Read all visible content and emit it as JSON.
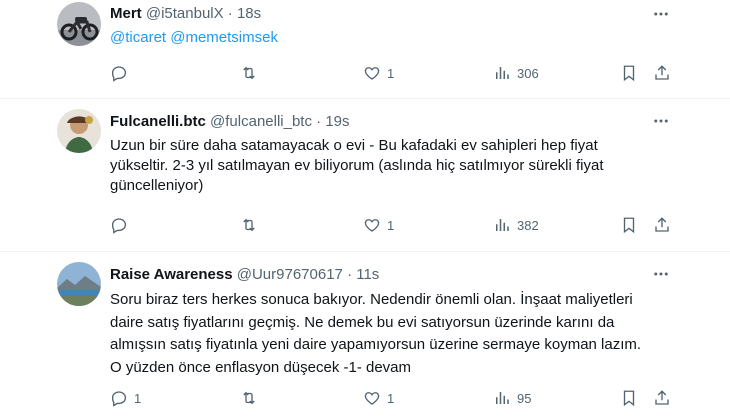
{
  "tweets": [
    {
      "name": "Mert",
      "handle": "@i5tanbulX",
      "dot": "·",
      "time": "18s",
      "mentions": "@ticaret @memetsimsek",
      "text": "",
      "replies": "",
      "retweets": "",
      "likes": "1",
      "views": "306"
    },
    {
      "name": "Fulcanelli.btc",
      "handle": "@fulcanelli_btc",
      "dot": "·",
      "time": "19s",
      "mentions": "",
      "text": "Uzun bir süre daha satamayacak o evi - Bu kafadaki ev sahipleri hep fiyat yükseltir. 2-3 yıl satılmayan ev biliyorum (aslında hiç satılmıyor sürekli fiyat güncelleniyor)",
      "replies": "",
      "retweets": "",
      "likes": "1",
      "views": "382"
    },
    {
      "name": "Raise Awareness",
      "handle": "@Uur97670617",
      "dot": "·",
      "time": "11s",
      "mentions": "",
      "text": "Soru biraz ters herkes sonuca bakıyor. Nedendir önemli olan. İnşaat maliyetleri daire satış fiyatlarını geçmiş. Ne demek bu evi satıyorsun üzerinde karını da almışsın satış fiyatınla yeni daire yapamıyorsun üzerine sermaye koyman lazım. O yüzden önce enflasyon düşecek -1- devam",
      "replies": "1",
      "retweets": "",
      "likes": "1",
      "views": "95"
    }
  ],
  "colors": {
    "text": "#0f1419",
    "muted": "#536471",
    "link": "#1d9bf0",
    "border": "#eff3f4"
  },
  "icons": [
    "more-icon",
    "reply-icon",
    "retweet-icon",
    "like-icon",
    "views-icon",
    "bookmark-icon",
    "share-icon"
  ]
}
